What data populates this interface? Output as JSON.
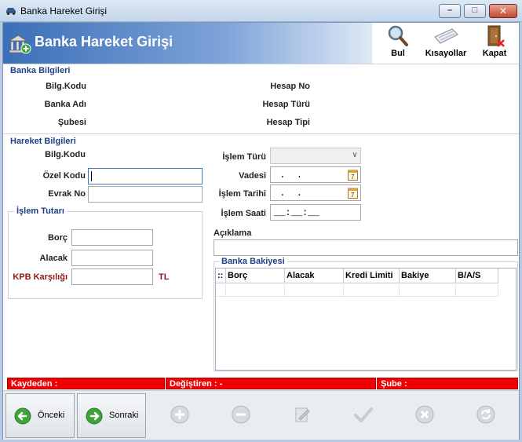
{
  "window": {
    "title": "Banka Hareket Girişi",
    "icons": {
      "app": "car-icon",
      "minimize": "minimize-icon",
      "maximize": "maximize-icon",
      "close": "close-icon"
    }
  },
  "header": {
    "title": "Banka Hareket Girişi",
    "icon": "bank-add-icon"
  },
  "toolbar": {
    "bul_label": "Bul",
    "kisayollar_label": "Kısayollar",
    "kapat_label": "Kapat"
  },
  "banka_bilgileri": {
    "title": "Banka Bilgileri",
    "bilg_kodu_label": "Bilg.Kodu",
    "banka_adi_label": "Banka Adı",
    "subesi_label": "Şubesi",
    "hesap_no_label": "Hesap No",
    "hesap_turu_label": "Hesap Türü",
    "hesap_tipi_label": "Hesap Tipi"
  },
  "hareket_bilgileri": {
    "title": "Hareket Bilgileri",
    "bilg_kodu_label": "Bilg.Kodu",
    "ozel_kodu_label": "Özel Kodu",
    "ozel_kodu_value": "",
    "evrak_no_label": "Evrak No",
    "evrak_no_value": "",
    "islem_turu_label": "İşlem Türü",
    "islem_turu_value": "",
    "vadesi_label": "Vadesi",
    "vadesi_value": " .  .",
    "islem_tarihi_label": "İşlem Tarihi",
    "islem_tarihi_value": " .  .",
    "islem_saati_label": "İşlem Saati",
    "islem_saati_value": "__:__:__",
    "aciklama_label": "Açıklama",
    "aciklama_value": "",
    "calendar_day": "7"
  },
  "islem_tutari": {
    "title": "İşlem Tutarı",
    "borc_label": "Borç",
    "borc_value": "",
    "alacak_label": "Alacak",
    "alacak_value": "",
    "kpb_label": "KPB Karşılığı",
    "kpb_value": "",
    "currency": "TL"
  },
  "banka_bakiyesi": {
    "title": "Banka Bakiyesi",
    "columns": [
      ":: ",
      "Borç",
      "Alacak",
      "Kredi Limiti",
      "Bakiye",
      "B/A/S"
    ]
  },
  "status": {
    "kaydeden": "Kaydeden :",
    "degistiren": "Değiştiren :  -",
    "sube": "Şube  :"
  },
  "nav": {
    "onceki_label": "Önceki",
    "sonraki_label": "Sonraki",
    "actions": [
      "add-icon",
      "remove-icon",
      "edit-icon",
      "check-icon",
      "cancel-icon",
      "refresh-icon"
    ]
  },
  "colors": {
    "accent": "#1f3e86",
    "status_red": "#f00000",
    "label_red": "#8b1a1a",
    "banner_blue": "#3b6fb8",
    "nav_green": "#3fa33a"
  }
}
